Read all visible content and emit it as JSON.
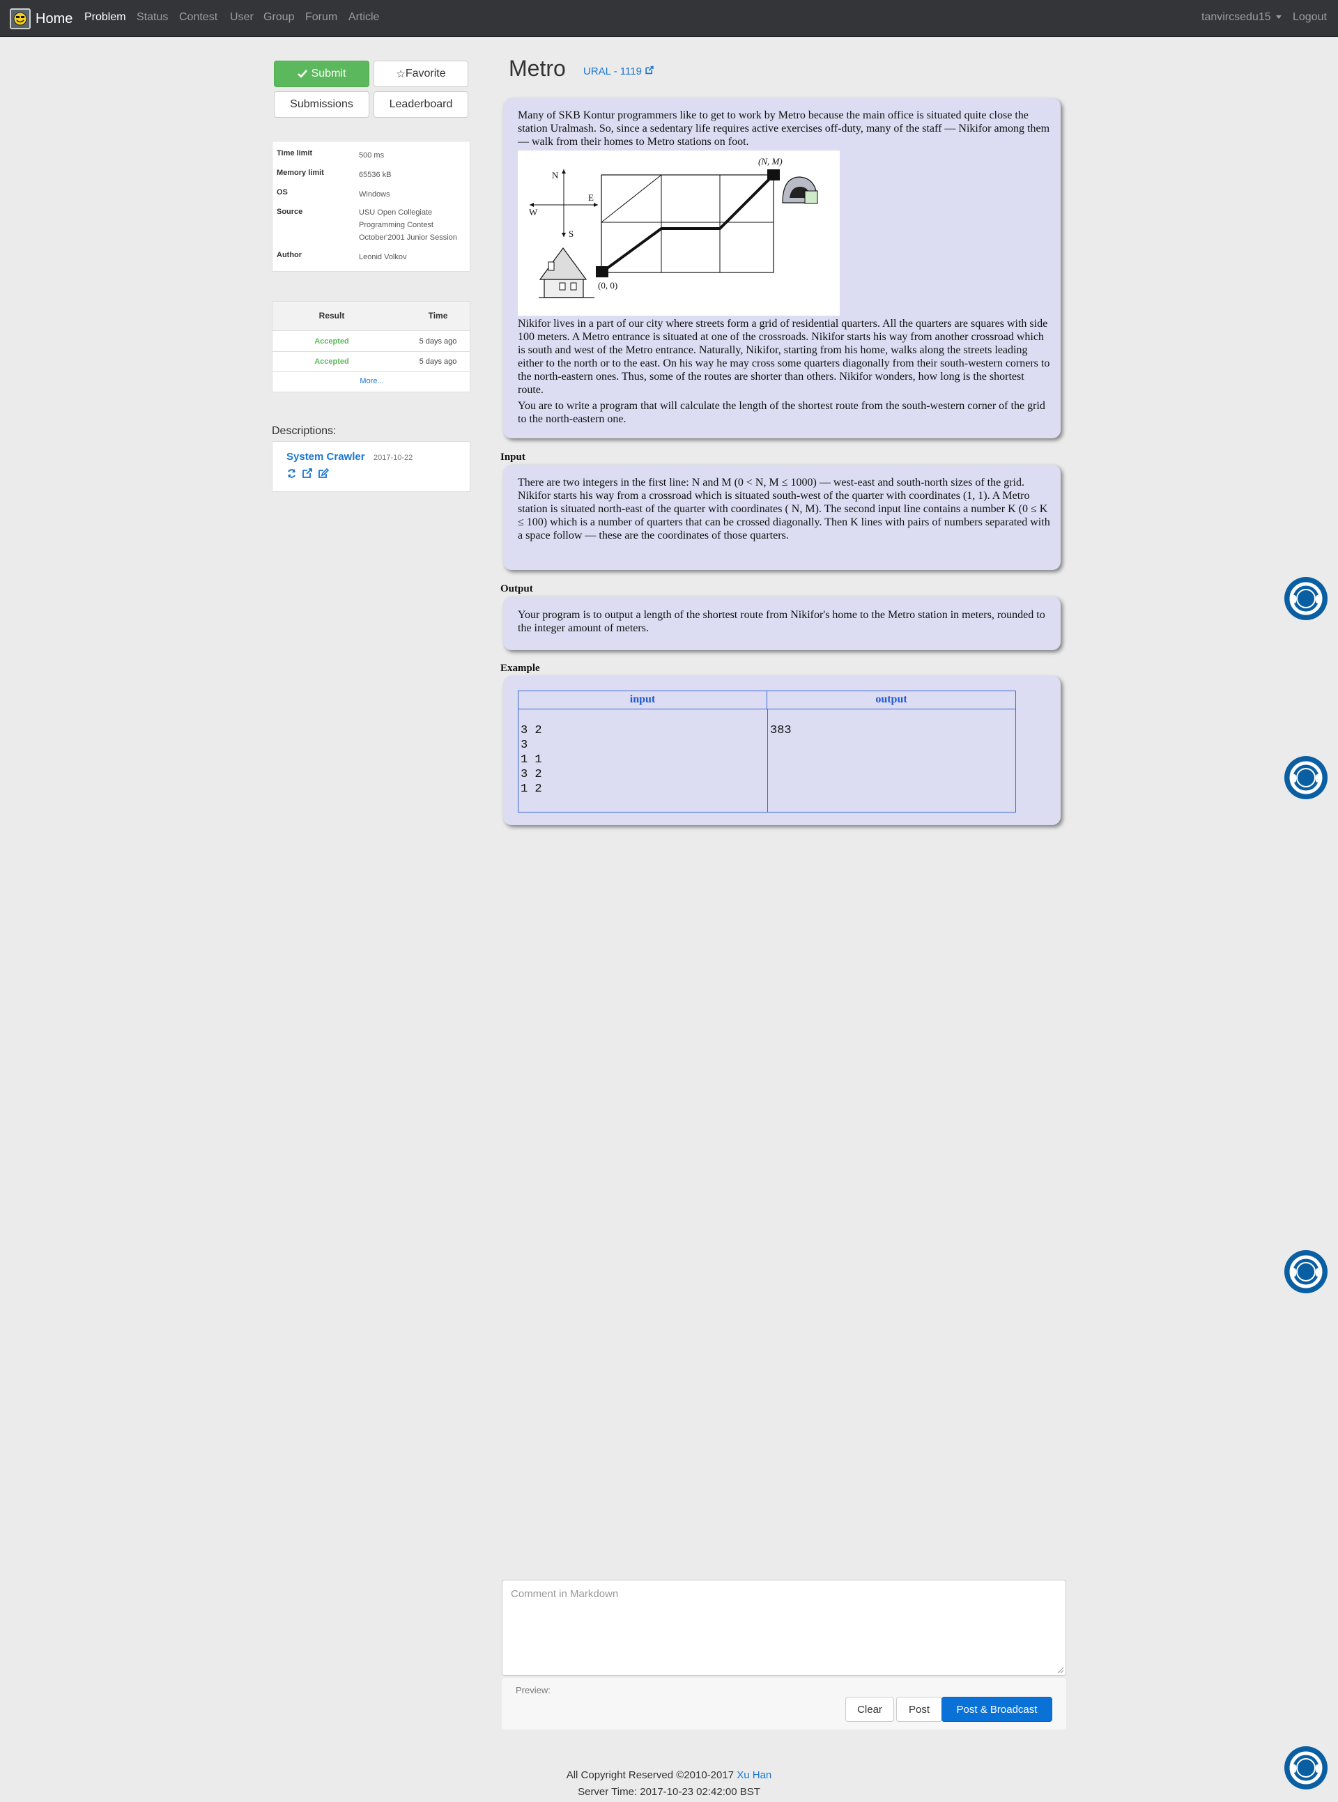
{
  "navbar": {
    "brand": "Home",
    "links": [
      "Problem",
      "Status",
      "Contest",
      "User",
      "Group",
      "Forum",
      "Article"
    ],
    "user": "tanvircsedu15",
    "logout": "Logout"
  },
  "actions": {
    "submit": "Submit",
    "favorite": "Favorite",
    "submissions": "Submissions",
    "leaderboard": "Leaderboard"
  },
  "info": [
    {
      "label": "Time limit",
      "value": "500 ms"
    },
    {
      "label": "Memory limit",
      "value": "65536 kB"
    },
    {
      "label": "OS",
      "value": "Windows"
    },
    {
      "label": "Source",
      "value": "USU Open Collegiate Programming Contest October'2001 Junior Session"
    },
    {
      "label": "Author",
      "value": "Leonid Volkov"
    }
  ],
  "status": {
    "headers": [
      "Result",
      "Time"
    ],
    "rows": [
      {
        "result": "Accepted",
        "time": "5 days ago"
      },
      {
        "result": "Accepted",
        "time": "5 days ago"
      }
    ],
    "more": "More..."
  },
  "descriptions": {
    "label": "Descriptions:",
    "author": "System Crawler",
    "date": "2017-10-22"
  },
  "problem": {
    "title": "Metro",
    "origin": "URAL - 1119",
    "statement_p1": "Many of SKB Kontur programmers like to get to work by Metro because the main office is situated quite close the station Uralmash. So, since a sedentary life requires active exercises off-duty, many of the staff — Nikifor among them — walk from their homes to Metro stations on foot.",
    "statement_p2": "Nikifor lives in a part of our city where streets form a grid of residential quarters. All the quarters are squares with side 100 meters. A Metro entrance is situated at one of the crossroads. Nikifor starts his way from another crossroad which is south and west of the Metro entrance. Naturally, Nikifor, starting from his home, walks along the streets leading either to the north or to the east. On his way he may cross some quarters diagonally from their south-western corners to the north-eastern ones. Thus, some of the routes are shorter than others. Nikifor wonders, how long is the shortest route.",
    "statement_p3": "You are to write a program that will calculate the length of the shortest route from the south-western corner of the grid to the north-eastern one.",
    "figure": {
      "north": "N",
      "east": "E",
      "west": "W",
      "south": "S",
      "origin_label": "(0, 0)",
      "target_label": "(N, M)"
    },
    "input_heading": "Input",
    "input_text": "There are two integers in the first line: N and M (0 < N, M ≤ 1000) — west-east and south-north sizes of the grid. Nikifor starts his way from a crossroad which is situated south-west of the quarter with coordinates (1, 1). A Metro station is situated north-east of the quarter with coordinates ( N, M). The second input line contains a number K (0 ≤ K ≤ 100) which is a number of quarters that can be crossed diagonally. Then K lines with pairs of numbers separated with a space follow — these are the coordinates of those quarters.",
    "output_heading": "Output",
    "output_text": "Your program is to output a length of the shortest route from Nikifor's home to the Metro station in meters, rounded to the integer amount of meters.",
    "example_heading": "Example",
    "example": {
      "input_header": "input",
      "output_header": "output",
      "input": "3 2\n3\n1 1\n3 2\n1 2",
      "output": "383"
    }
  },
  "comment": {
    "placeholder": "Comment in Markdown",
    "preview_label": "Preview:",
    "clear": "Clear",
    "post": "Post",
    "broadcast": "Post & Broadcast"
  },
  "footer": {
    "copyright": "All Copyright Reserved ©2010-2017",
    "author": "Xu Han",
    "server_time": "Server Time: 2017-10-23 02:42:00 BST"
  },
  "colors": {
    "navbar": "#333539",
    "success": "#5cb85c",
    "link": "#1976d2",
    "panel": "#dcdcf2",
    "primary": "#0a72d6"
  }
}
